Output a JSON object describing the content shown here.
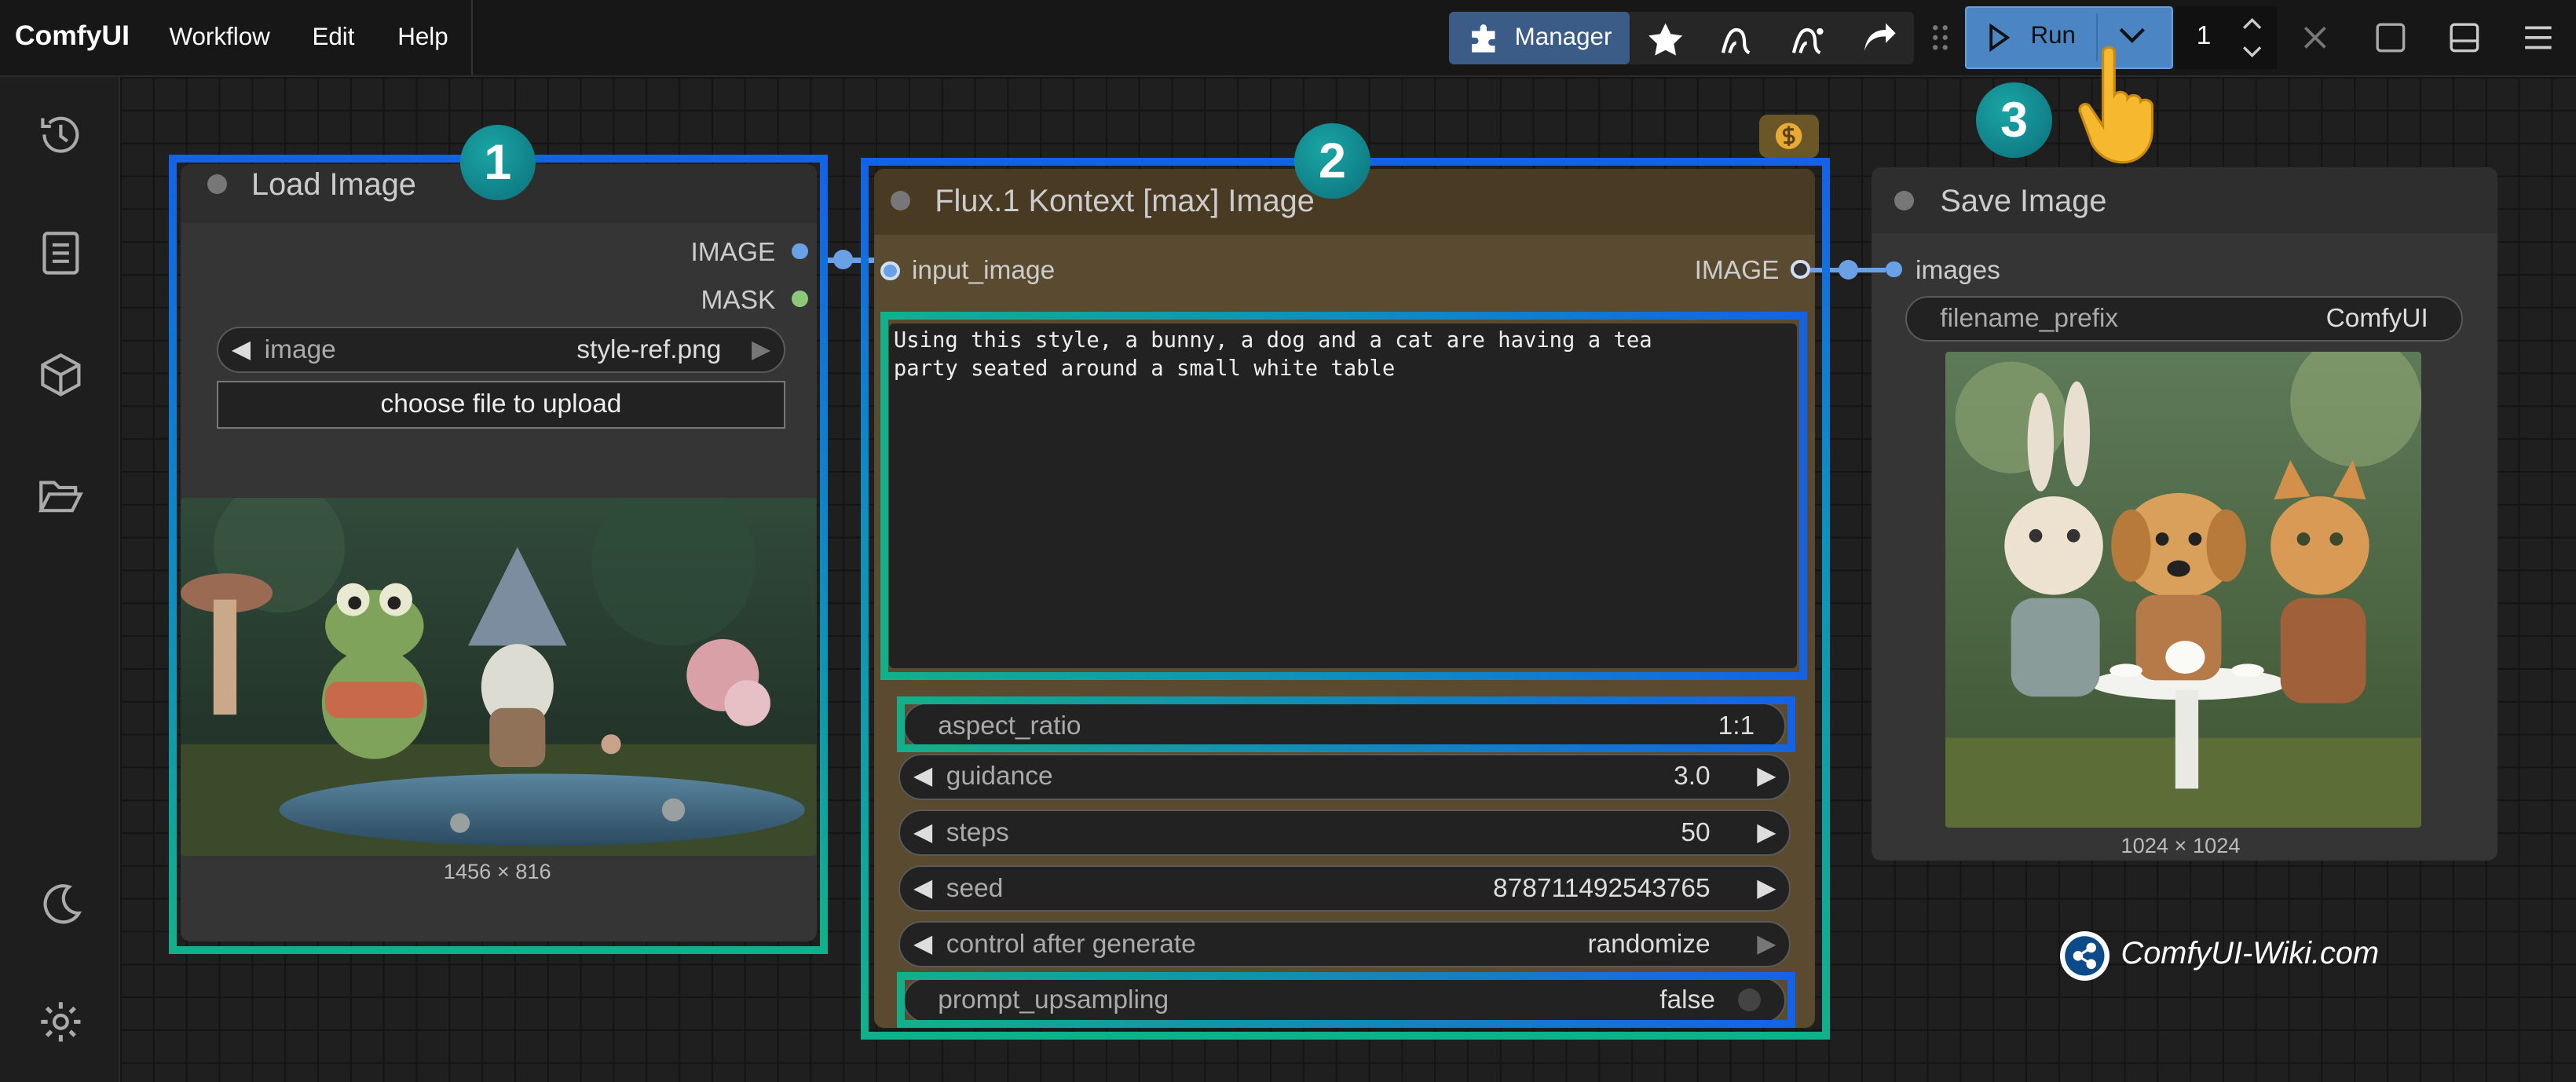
{
  "topbar": {
    "brand": "ComfyUI",
    "menu": [
      "Workflow",
      "Edit",
      "Help"
    ],
    "manager_label": "Manager",
    "run_label": "Run",
    "queue_count": "1"
  },
  "nodes": {
    "load_image": {
      "title": "Load Image",
      "outputs": [
        "IMAGE",
        "MASK"
      ],
      "image_widget": {
        "name": "image",
        "value": "style-ref.png"
      },
      "upload_label": "choose file to upload",
      "dims": "1456 × 816"
    },
    "flux": {
      "title": "Flux.1 Kontext [max] Image",
      "input": "input_image",
      "output": "IMAGE",
      "prompt": "Using this style, a bunny, a dog and a cat are having a tea\nparty seated around a small white table",
      "widgets": [
        {
          "name": "aspect_ratio",
          "value": "1:1"
        },
        {
          "name": "guidance",
          "value": "3.0"
        },
        {
          "name": "steps",
          "value": "50"
        },
        {
          "name": "seed",
          "value": "878711492543765"
        },
        {
          "name": "control after generate",
          "value": "randomize"
        },
        {
          "name": "prompt_upsampling",
          "value": "false"
        }
      ]
    },
    "save_image": {
      "title": "Save Image",
      "input": "images",
      "filename_widget": {
        "name": "filename_prefix",
        "value": "ComfyUI"
      },
      "dims": "1024 × 1024"
    }
  },
  "badges": [
    "1",
    "2",
    "3"
  ],
  "watermark": "ComfyUI-Wiki.com",
  "colors": {
    "frame_teal": "#12b08a",
    "frame_blue": "#1463e6",
    "link": "#6aa0e6",
    "run_button": "#4c85c4",
    "manager_button": "#3a5c86"
  }
}
